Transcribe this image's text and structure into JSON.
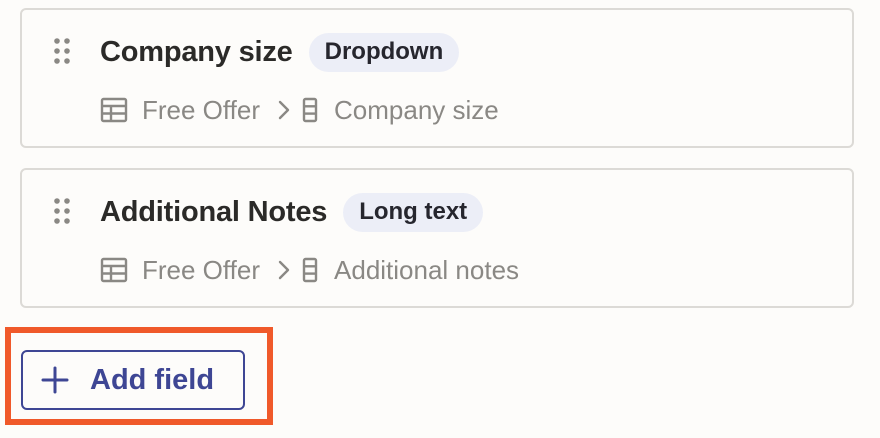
{
  "fields": [
    {
      "title": "Company size",
      "type_badge": "Dropdown",
      "table_name": "Free Offer",
      "column_name": "Company size"
    },
    {
      "title": "Additional Notes",
      "type_badge": "Long text",
      "table_name": "Free Offer",
      "column_name": "Additional notes"
    }
  ],
  "add_field_button": {
    "label": "Add field",
    "icon": "plus-icon"
  },
  "icons": {
    "drag": "drag-handle-icon",
    "table": "table-icon",
    "separator": "chevron-right-icon",
    "column": "column-icon"
  },
  "colors": {
    "accent": "#3e4694",
    "highlight": "#f0592a",
    "badge_bg": "#eceef7",
    "muted_text": "#8a8884",
    "card_border": "#dcdad6"
  }
}
